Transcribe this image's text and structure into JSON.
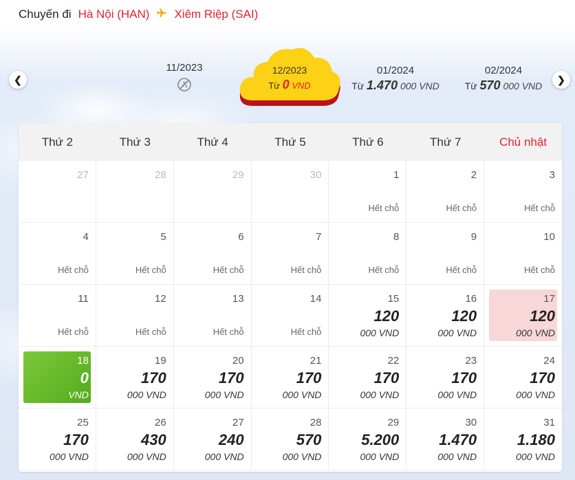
{
  "route": {
    "label": "Chuyến đi",
    "origin": "Hà Nội (HAN)",
    "destination": "Xiêm Riệp (SAI)"
  },
  "months": {
    "prev": {
      "label": "11/2023"
    },
    "selected": {
      "label": "12/2023",
      "from": "Từ",
      "price": "0",
      "currency": "VND"
    },
    "next1": {
      "label": "01/2024",
      "from": "Từ",
      "price": "1.470",
      "currency": "000 VND"
    },
    "next2": {
      "label": "02/2024",
      "from": "Từ",
      "price": "570",
      "currency": "000 VND"
    }
  },
  "weekdays": [
    "Thứ 2",
    "Thứ 3",
    "Thứ 4",
    "Thứ 5",
    "Thứ 6",
    "Thứ 7",
    "Chủ nhật"
  ],
  "days": [
    {
      "day": "27",
      "state": "past"
    },
    {
      "day": "28",
      "state": "past"
    },
    {
      "day": "29",
      "state": "past"
    },
    {
      "day": "30",
      "state": "past"
    },
    {
      "day": "1",
      "status": "Hết chỗ"
    },
    {
      "day": "2",
      "status": "Hết chỗ"
    },
    {
      "day": "3",
      "status": "Hết chỗ"
    },
    {
      "day": "4",
      "status": "Hết chỗ"
    },
    {
      "day": "5",
      "status": "Hết chỗ"
    },
    {
      "day": "6",
      "status": "Hết chỗ"
    },
    {
      "day": "7",
      "status": "Hết chỗ"
    },
    {
      "day": "8",
      "status": "Hết chỗ"
    },
    {
      "day": "9",
      "status": "Hết chỗ"
    },
    {
      "day": "10",
      "status": "Hết chỗ"
    },
    {
      "day": "11",
      "status": "Hết chỗ"
    },
    {
      "day": "12",
      "status": "Hết chỗ"
    },
    {
      "day": "13",
      "status": "Hết chỗ"
    },
    {
      "day": "14",
      "status": "Hết chỗ"
    },
    {
      "day": "15",
      "price": "120",
      "currency": "000 VND"
    },
    {
      "day": "16",
      "price": "120",
      "currency": "000 VND"
    },
    {
      "day": "17",
      "price": "120",
      "currency": "000 VND",
      "state": "highlight"
    },
    {
      "day": "18",
      "price": "0",
      "currency": "VND",
      "state": "selected"
    },
    {
      "day": "19",
      "price": "170",
      "currency": "000 VND"
    },
    {
      "day": "20",
      "price": "170",
      "currency": "000 VND"
    },
    {
      "day": "21",
      "price": "170",
      "currency": "000 VND"
    },
    {
      "day": "22",
      "price": "170",
      "currency": "000 VND"
    },
    {
      "day": "23",
      "price": "170",
      "currency": "000 VND"
    },
    {
      "day": "24",
      "price": "170",
      "currency": "000 VND"
    },
    {
      "day": "25",
      "price": "170",
      "currency": "000 VND"
    },
    {
      "day": "26",
      "price": "430",
      "currency": "000 VND"
    },
    {
      "day": "27",
      "price": "240",
      "currency": "000 VND"
    },
    {
      "day": "28",
      "price": "570",
      "currency": "000 VND"
    },
    {
      "day": "29",
      "price": "5.200",
      "currency": "000 VND"
    },
    {
      "day": "30",
      "price": "1.470",
      "currency": "000 VND"
    },
    {
      "day": "31",
      "price": "1.180",
      "currency": "000 VND"
    }
  ],
  "colors": {
    "accent_red": "#e0242c",
    "plane_yellow": "#f2a000",
    "selected_green": "#66b82a",
    "highlight_pink": "#f8d7d8",
    "cloud_yellow": "#fcd116"
  },
  "icons": {
    "prev": "chevron-left-icon",
    "next": "chevron-right-icon",
    "plane": "plane-icon",
    "no_flight": "no-flight-icon"
  }
}
